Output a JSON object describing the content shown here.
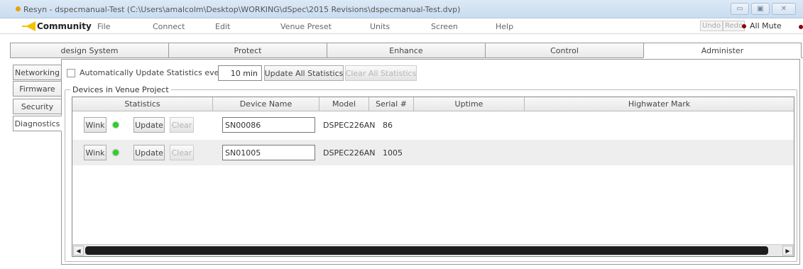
{
  "window": {
    "title": "Resyn - dspecmanual-Test (C:\\Users\\amalcolm\\Desktop\\WORKING\\dSpec\\2015 Revisions\\dspecmanual-Test.dvp)",
    "minimize": "▭",
    "maximize": "▣",
    "close": "✕"
  },
  "menubar": {
    "brand": "Community",
    "items": [
      "File",
      "Connect",
      "Edit",
      "Venue Preset",
      "Units",
      "Screen",
      "Help"
    ],
    "undo": "Undo",
    "redo": "Redo",
    "all_mute": "All Mute"
  },
  "main_tabs": [
    "design System",
    "Protect",
    "Enhance",
    "Control",
    "Administer"
  ],
  "active_main_tab": "Administer",
  "side_tabs": [
    "Networking",
    "Firmware",
    "Security",
    "Diagnostics"
  ],
  "active_side_tab": "Diagnostics",
  "options": {
    "auto_update_label": "Automatically Update Statistics every",
    "auto_update_checked": false,
    "interval_value": "10 min",
    "update_all_label": "Update All Statistics",
    "clear_all_label": "Clear All Statistics"
  },
  "group": {
    "legend": "Devices in Venue Project"
  },
  "table": {
    "columns": [
      "Statistics",
      "Device Name",
      "Model",
      "Serial #",
      "Uptime",
      "Highwater Mark"
    ],
    "rows": [
      {
        "wink": "Wink",
        "update": "Update",
        "clear": "Clear",
        "status": "online",
        "device_name": "SN00086",
        "model": "DSPEC226AN",
        "serial": "86",
        "uptime": "",
        "highwater": ""
      },
      {
        "wink": "Wink",
        "update": "Update",
        "clear": "Clear",
        "status": "online",
        "device_name": "SN01005",
        "model": "DSPEC226AN",
        "serial": "1005",
        "uptime": "",
        "highwater": ""
      }
    ]
  },
  "scrollbar": {
    "left_arrow": "◀",
    "right_arrow": "▶"
  },
  "colors": {
    "status_online": "#33cc33",
    "mute_indicator": "#8b0000",
    "logo": "#f2c200"
  }
}
